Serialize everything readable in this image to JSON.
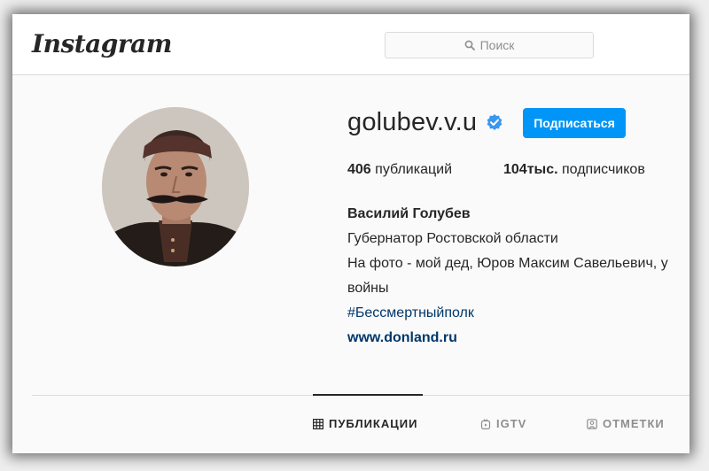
{
  "header": {
    "logo": "Instagram",
    "search_placeholder": "Поиск"
  },
  "profile": {
    "username": "golubev.v.u",
    "verified": true,
    "follow_label": "Подписаться",
    "stats": [
      {
        "count": "406",
        "label": "публикаций"
      },
      {
        "count": "104тыс.",
        "label": "подписчиков"
      }
    ],
    "bio": {
      "name": "Василий Голубев",
      "lines": [
        "Губернатор Ростовской области",
        "На фото - мой дед, Юров Максим Савельевич, у",
        "войны"
      ],
      "hashtag": "#Бессмертныйполк",
      "website": "www.donland.ru"
    }
  },
  "tabs": [
    {
      "label": "ПУБЛИКАЦИИ",
      "icon": "grid-icon",
      "active": true
    },
    {
      "label": "IGTV",
      "icon": "igtv-icon",
      "active": false
    },
    {
      "label": "ОТМЕТКИ",
      "icon": "tagged-icon",
      "active": false
    }
  ],
  "colors": {
    "accent": "#0095f6",
    "link": "#00376b",
    "verified": "#3897f0",
    "text": "#262626",
    "muted": "#8e8e8e"
  }
}
